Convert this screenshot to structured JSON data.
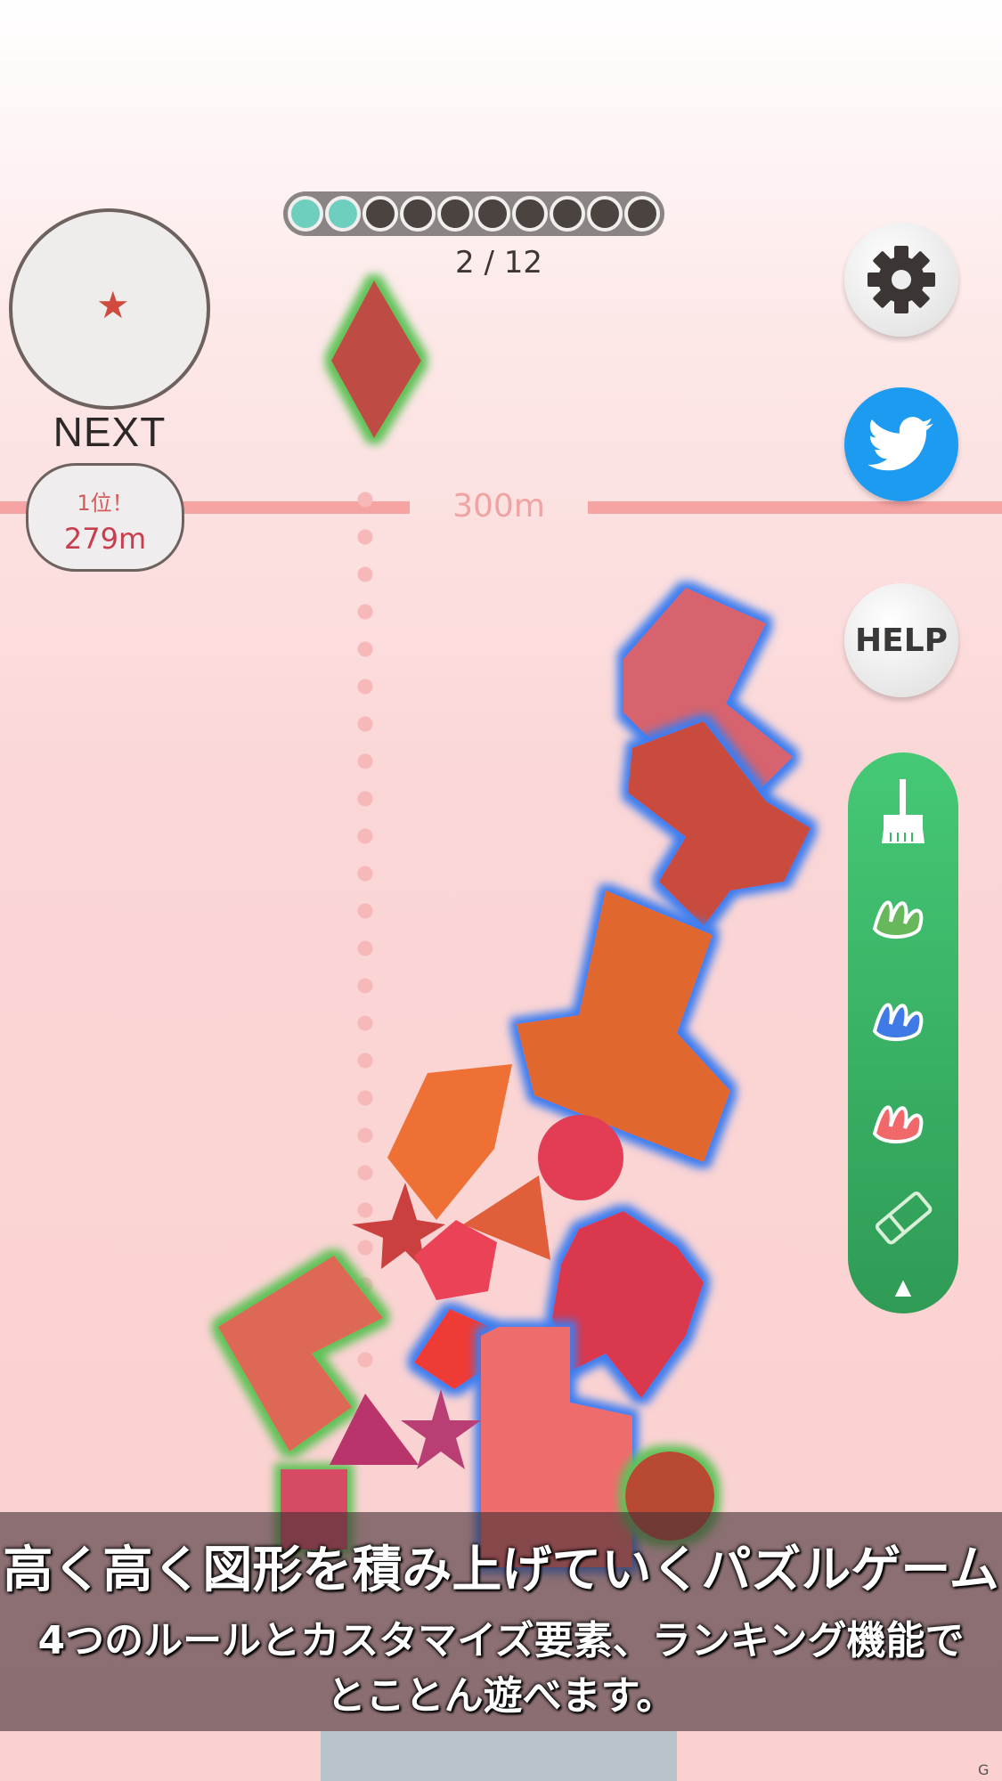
{
  "progress": {
    "current_text": "2 / 12",
    "dots_done": 2,
    "dots_total": 10,
    "color_done": "#6fcfbe",
    "color_pending": "#4a4340"
  },
  "next": {
    "label": "NEXT",
    "piece_icon": "star-icon"
  },
  "height_marker": {
    "label": "300m"
  },
  "rank": {
    "position": "1位！",
    "value": "279m"
  },
  "buttons": {
    "settings_icon": "gear-icon",
    "twitter_icon": "twitter-icon",
    "help_label": "HELP"
  },
  "toolbar": {
    "tools": [
      "broom-icon",
      "green-paint-icon",
      "blue-paint-icon",
      "red-paint-icon",
      "eraser-icon"
    ],
    "expand_icon": "▲"
  },
  "caption": {
    "main": "高く高く図形を積み上げていくパズルゲーム",
    "sub_line1": "4つのルールとカスタマイズ要素、ランキング機能で",
    "sub_line2": "とことん遊べます。"
  },
  "colors": {
    "accent_green": "#3fbf6e",
    "twitter_blue": "#1d9bf0",
    "height_line": "#f6a3a3"
  }
}
